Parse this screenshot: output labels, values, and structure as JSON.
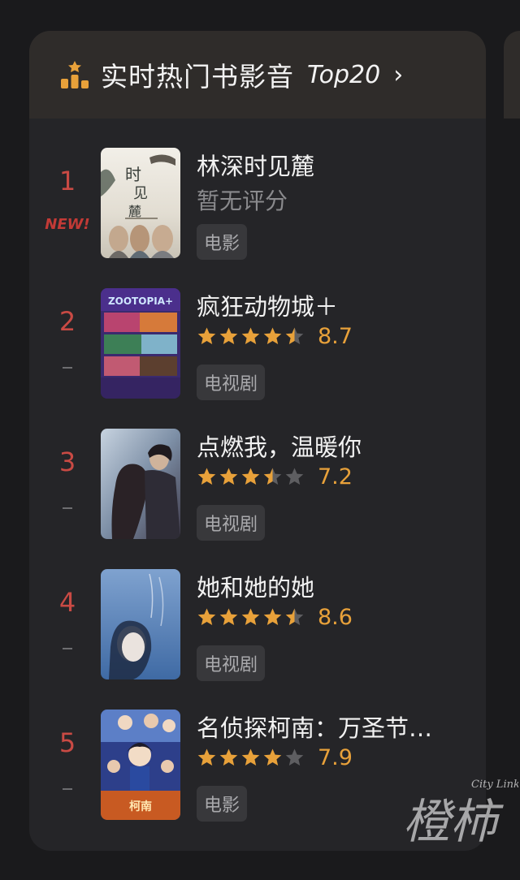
{
  "header": {
    "title": "实时热门书影音",
    "top_label": "Top20",
    "chevron": "›",
    "icon": "podium-icon",
    "accent": "#e8a13a"
  },
  "items": [
    {
      "rank": "1",
      "badge": "NEW!",
      "title": "林深时见麓",
      "rating_text": "暂无评分",
      "stars": null,
      "score": "",
      "tag": "电影"
    },
    {
      "rank": "2",
      "badge": "",
      "title": "疯狂动物城＋",
      "rating_text": "",
      "stars": 4.5,
      "score": "8.7",
      "tag": "电视剧",
      "poster_text": "ZOOTOPIA+"
    },
    {
      "rank": "3",
      "badge": "",
      "title": "点燃我，温暖你",
      "rating_text": "",
      "stars": 3.5,
      "score": "7.2",
      "tag": "电视剧"
    },
    {
      "rank": "4",
      "badge": "",
      "title": "她和她的她",
      "rating_text": "",
      "stars": 4.5,
      "score": "8.6",
      "tag": "电视剧"
    },
    {
      "rank": "5",
      "badge": "",
      "title": "名侦探柯南：万圣节…",
      "rating_text": "",
      "stars": 4,
      "score": "7.9",
      "tag": "电影"
    }
  ],
  "watermark": {
    "text_main": "橙柿",
    "text_small": "City Link"
  },
  "colors": {
    "rank": "#c94a44",
    "star_on": "#e8a13a",
    "star_off": "#5e5e61",
    "background": "#1a1a1c",
    "card": "#252528"
  }
}
